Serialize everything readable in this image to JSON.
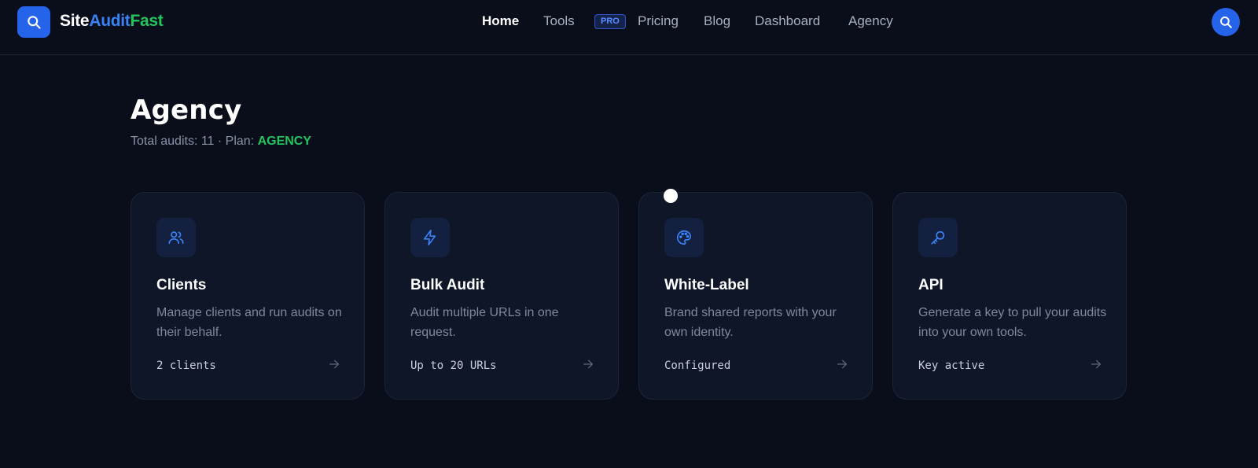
{
  "brand": {
    "part1": "Site",
    "part2": "Audit",
    "part3": "Fast"
  },
  "nav": {
    "home": "Home",
    "tools": "Tools",
    "tools_badge": "PRO",
    "pricing": "Pricing",
    "blog": "Blog",
    "dashboard": "Dashboard",
    "agency": "Agency"
  },
  "page": {
    "title": "Agency",
    "subtitle_prefix": "Total audits: 11 · Plan: ",
    "plan": "AGENCY"
  },
  "cards": [
    {
      "icon": "users-icon",
      "title": "Clients",
      "description": "Manage clients and run audits on their behalf.",
      "status": "2 clients"
    },
    {
      "icon": "bolt-icon",
      "title": "Bulk Audit",
      "description": "Audit multiple URLs in one request.",
      "status": "Up to 20 URLs"
    },
    {
      "icon": "palette-icon",
      "title": "White-Label",
      "description": "Brand shared reports with your own identity.",
      "status": "Configured"
    },
    {
      "icon": "key-icon",
      "title": "API",
      "description": "Generate a key to pull your audits into your own tools.",
      "status": "Key active"
    }
  ],
  "colors": {
    "background": "#0a0e1a",
    "accent": "#2563eb",
    "green": "#22c55e"
  }
}
